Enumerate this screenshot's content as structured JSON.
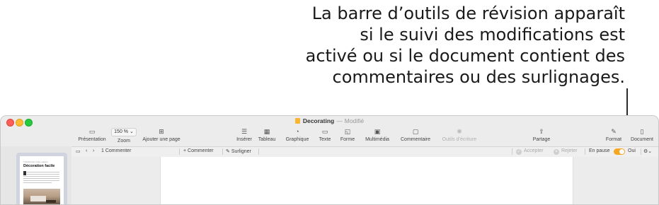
{
  "callout": {
    "lines": [
      "La barre d’outils de révision apparaît",
      "si le suivi des modifications est",
      "activé ou si le document contient des",
      "commentaires ou des surlignages."
    ]
  },
  "window": {
    "doc_name": "Decorating",
    "separator": "—",
    "status": "Modifié"
  },
  "toolbar": {
    "presentation": "Présentation",
    "zoom_value": "150 % ⌄",
    "zoom": "Zoom",
    "add_page": "Ajouter une page",
    "insert": "Insérer",
    "table": "Tableau",
    "chart": "Graphique",
    "text": "Texte",
    "shape": "Forme",
    "media": "Multimédia",
    "comment": "Commentaire",
    "writing_tools": "Outils d’écriture",
    "share": "Partage",
    "format": "Format",
    "document": "Document"
  },
  "review_bar": {
    "comment_count": "1 Commenter",
    "add_comment": "+ Commenter",
    "highlight": "Surligner",
    "accept": "Accepter",
    "reject": "Rejeter",
    "paused": "En pause",
    "on": "Oui"
  },
  "thumbnail": {
    "kicker": "Transformez votre maison",
    "title": "Décoration facile"
  }
}
